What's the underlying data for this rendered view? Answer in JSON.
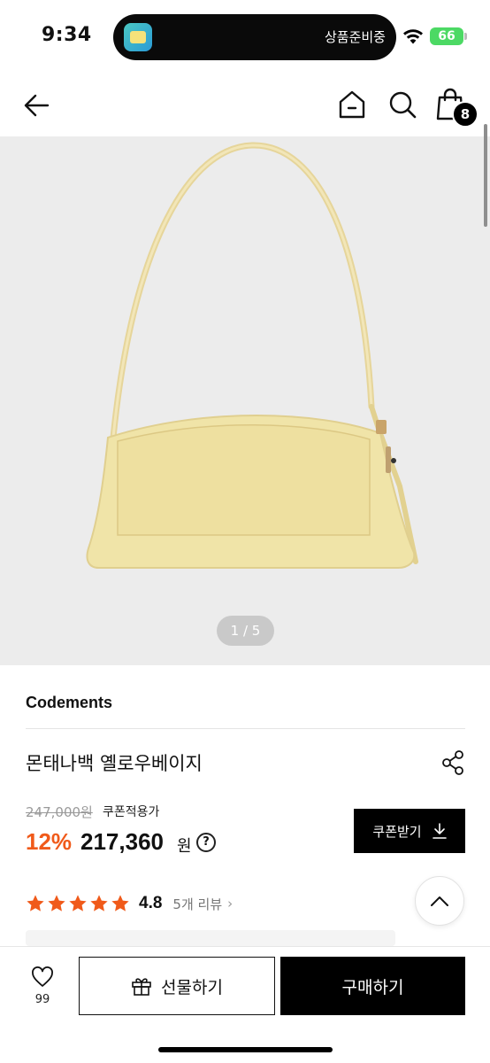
{
  "status_bar": {
    "time": "9:34",
    "island_text": "상품준비중",
    "battery": "66",
    "icons": [
      "app-icon",
      "wifi-icon",
      "battery-icon"
    ]
  },
  "header": {
    "icons": [
      "back-arrow-icon",
      "home-icon",
      "search-icon",
      "shopping-bag-icon"
    ],
    "cart_count": "8"
  },
  "gallery": {
    "counter": "1 / 5",
    "bag_color": "#f0e4a8"
  },
  "product": {
    "brand": "Codements",
    "name": "몬태나백 옐로우베이지",
    "original_price": "247,000원",
    "coupon_applied_label": "쿠폰적용가",
    "discount": "12%",
    "price": "217,360",
    "currency": "원",
    "help": "?",
    "coupon_button": "쿠폰받기",
    "rating": "4.8",
    "stars": 5,
    "reviews": "5개 리뷰",
    "review_chevron": "›"
  },
  "bottom_bar": {
    "like_count": "99",
    "gift_button": "선물하기",
    "buy_button": "구매하기"
  },
  "colors": {
    "accent": "#f05a1a",
    "primary": "#000000",
    "background_gallery": "#ececec"
  }
}
